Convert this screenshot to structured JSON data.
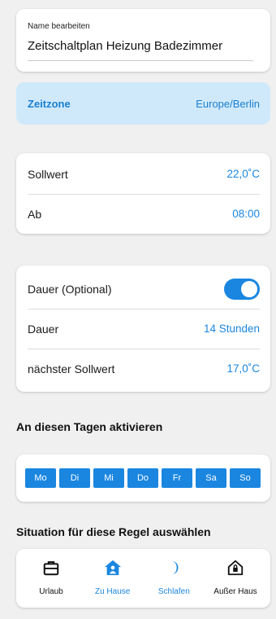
{
  "name_field": {
    "label": "Name bearbeiten",
    "value": "Zeitschaltplan Heizung Badezimmer"
  },
  "timezone": {
    "label": "Zeitzone",
    "value": "Europe/Berlin"
  },
  "setpoint": {
    "label": "Sollwert",
    "value": "22,0˚C",
    "from_label": "Ab",
    "from_value": "08:00"
  },
  "duration": {
    "optional_label": "Dauer (Optional)",
    "toggle_on": true,
    "duration_label": "Dauer",
    "duration_value": "14 Stunden",
    "next_label": "nächster Sollwert",
    "next_value": "17,0˚C"
  },
  "days": {
    "title": "An diesen Tagen aktivieren",
    "items": [
      "Mo",
      "Di",
      "Mi",
      "Do",
      "Fr",
      "Sa",
      "So"
    ]
  },
  "situation": {
    "title": "Situation für diese Regel auswählen",
    "items": [
      {
        "label": "Urlaub",
        "icon": "suitcase-icon",
        "active": false
      },
      {
        "label": "Zu Hause",
        "icon": "home-person-icon",
        "active": true
      },
      {
        "label": "Schlafen",
        "icon": "moon-icon",
        "active": true
      },
      {
        "label": "Außer Haus",
        "icon": "house-lock-icon",
        "active": false
      }
    ]
  },
  "colors": {
    "accent": "#1a86e0",
    "timezone_bg": "#cfe9fb",
    "background": "#f0f0f0"
  }
}
